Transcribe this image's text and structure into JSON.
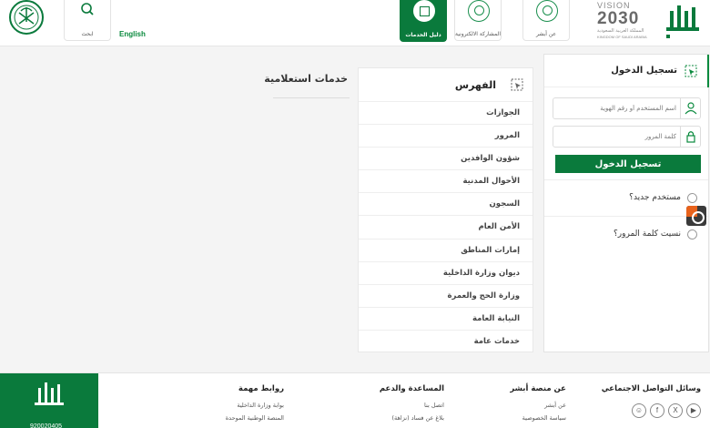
{
  "header": {
    "search_label": "ابحث",
    "language": "English",
    "tiles": [
      {
        "label": "دليل الخدمات",
        "active": true
      },
      {
        "label": "المشاركة الالكترونية",
        "active": false
      },
      {
        "label": "عن أبشر",
        "active": false
      }
    ],
    "vision": {
      "top": "VISION",
      "number": "2030",
      "ar": "المملكة العربية السعودية",
      "en": "KINGDOM OF SAUDI ARABIA"
    }
  },
  "login": {
    "title": "تسجيل الدخول",
    "username_placeholder": "اسم المستخدم أو رقم الهوية",
    "password_placeholder": "كلمة المرور",
    "button": "تسجيل الدخول",
    "new_user": "مستخدم جديد؟",
    "forgot_password": "نسيت كلمة المرور؟"
  },
  "index": {
    "title": "الفهرس",
    "items": [
      "الجوازات",
      "المرور",
      "شؤون الوافدين",
      "الأحوال المدنية",
      "السجون",
      "الأمن العام",
      "إمارات المناطق",
      "ديوان وزارة الداخلية",
      "وزارة الحج والعمرة",
      "النيابة العامة",
      "خدمات عامة"
    ]
  },
  "eservices_title": "خدمات استعلامية",
  "footer": {
    "social_title": "وسائل التواصل الاجتماعي",
    "about_title": "عن منصة أبشر",
    "about_links": [
      "عن أبشر",
      "سياسة الخصوصية"
    ],
    "support_title": "المساعدة والدعم",
    "support_links": [
      "اتصل بنا",
      "بلاغ عن فساد (نزاهة)"
    ],
    "links_title": "روابط مهمة",
    "links": [
      "بوابة وزارة الداخلية",
      "المنصة الوطنية الموحدة"
    ],
    "phone": "920020405"
  },
  "colors": {
    "primary": "#0a7a3c",
    "accent": "#0a8a3e"
  }
}
